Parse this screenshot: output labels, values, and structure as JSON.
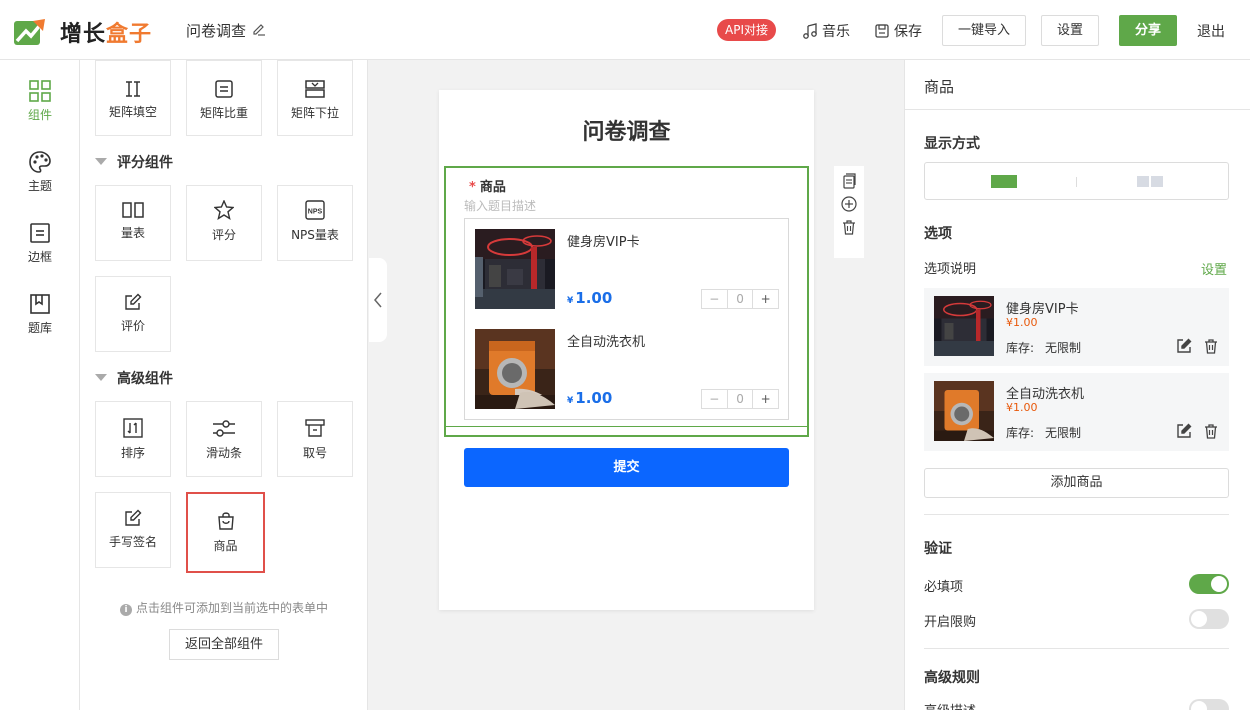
{
  "header": {
    "brand_part1": "增长",
    "brand_part2": "盒子",
    "doc_title": "问卷调查",
    "api_badge": "API对接",
    "music_label": "音乐",
    "save_label": "保存",
    "import_label": "一键导入",
    "settings_label": "设置",
    "share_label": "分享",
    "exit_label": "退出"
  },
  "left_nav": {
    "items": [
      {
        "label": "组件",
        "icon": "grid-icon",
        "active": true
      },
      {
        "label": "主题",
        "icon": "palette-icon",
        "active": false
      },
      {
        "label": "边框",
        "icon": "border-icon",
        "active": false
      },
      {
        "label": "题库",
        "icon": "library-icon",
        "active": false
      }
    ]
  },
  "component_panel": {
    "matrix_tiles": [
      "矩阵填空",
      "矩阵比重",
      "矩阵下拉"
    ],
    "rating_section": "评分组件",
    "rating_tiles": [
      "量表",
      "评分",
      "NPS量表",
      "评价"
    ],
    "advanced_section": "高级组件",
    "advanced_tiles": [
      "排序",
      "滑动条",
      "取号",
      "手写签名",
      "商品"
    ],
    "nps_icon_text": "NPS",
    "hint": "点击组件可添加到当前选中的表单中",
    "back_button": "返回全部组件"
  },
  "form": {
    "title": "问卷调查",
    "question": {
      "required_mark": "*",
      "title": "商品",
      "description_placeholder": "输入题目描述",
      "products": [
        {
          "name": "健身房VIP卡",
          "currency": "¥",
          "price": "1.00",
          "quantity": "0"
        },
        {
          "name": "全自动洗衣机",
          "currency": "¥",
          "price": "1.00",
          "quantity": "0"
        }
      ]
    },
    "submit_label": "提交"
  },
  "right_panel": {
    "title": "商品",
    "display_mode_label": "显示方式",
    "options_label": "选项",
    "options_desc_label": "选项说明",
    "options_settings_link": "设置",
    "options": [
      {
        "name": "健身房VIP卡",
        "price": "¥1.00",
        "stock_label": "库存:",
        "stock_value": "无限制"
      },
      {
        "name": "全自动洗衣机",
        "price": "¥1.00",
        "stock_label": "库存:",
        "stock_value": "无限制"
      }
    ],
    "add_product_label": "添加商品",
    "validation_label": "验证",
    "required_label": "必填项",
    "required_on": true,
    "limit_label": "开启限购",
    "limit_on": false,
    "advanced_rules_label": "高级规则",
    "advanced_desc_label": "高级描述",
    "advanced_desc_on": false
  },
  "colors": {
    "accent_green": "#5fa849",
    "submit_blue": "#0b66ff",
    "badge_red": "#e84a4a",
    "brand_orange": "#f07a30",
    "price_orange": "#e8590c"
  }
}
